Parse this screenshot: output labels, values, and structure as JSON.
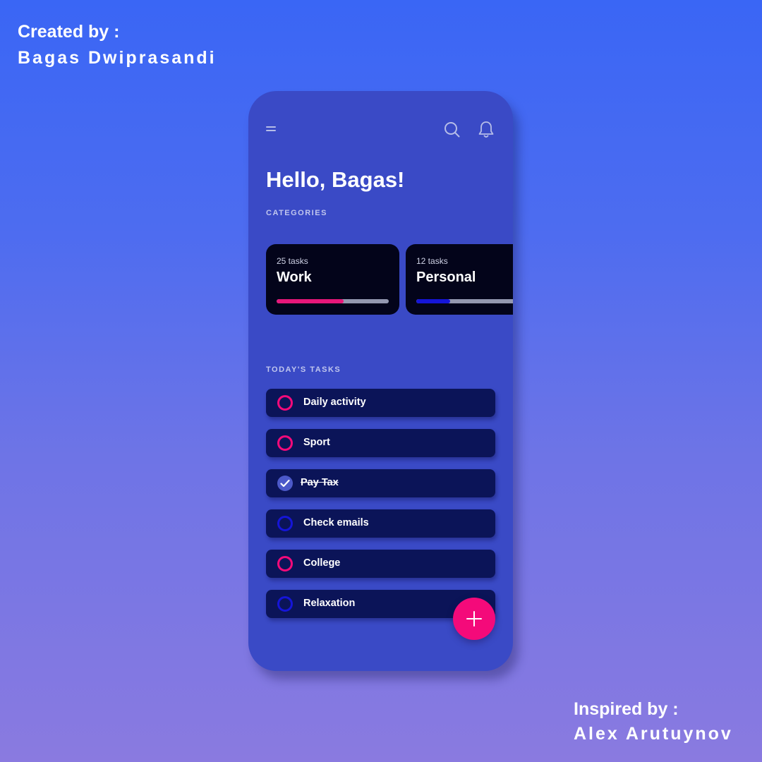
{
  "credits": {
    "created_label": "Created by :",
    "created_name": "Bagas Dwiprasandi",
    "inspired_label": "Inspired by :",
    "inspired_name": "Alex Arutuynov"
  },
  "header": {
    "icons": [
      "menu-icon",
      "search-icon",
      "bell-icon"
    ]
  },
  "greeting": "Hello, Bagas!",
  "categories": {
    "label": "CATEGORIES",
    "items": [
      {
        "count": "25 tasks",
        "name": "Work",
        "progress": 0.6,
        "color": "#e8177a"
      },
      {
        "count": "12 tasks",
        "name": "Personal",
        "progress": 0.3,
        "color": "#1515d8"
      }
    ]
  },
  "tasks": {
    "label": "TODAY'S TASKS",
    "items": [
      {
        "label": "Daily activity",
        "done": false,
        "color": "#f40a7a"
      },
      {
        "label": "Sport",
        "done": false,
        "color": "#f40a7a"
      },
      {
        "label": "Pay Tax",
        "done": true,
        "color": "#4c59c9"
      },
      {
        "label": "Check emails",
        "done": false,
        "color": "#1515d8"
      },
      {
        "label": "College",
        "done": false,
        "color": "#f40a7a"
      },
      {
        "label": "Relaxation",
        "done": false,
        "color": "#1515d8"
      }
    ]
  },
  "fab": {
    "icon": "plus-icon",
    "color": "#f40a7a"
  },
  "colors": {
    "phone_background": "#3a4ac6",
    "card_background": "#03041a",
    "task_background": "#0b1458"
  }
}
